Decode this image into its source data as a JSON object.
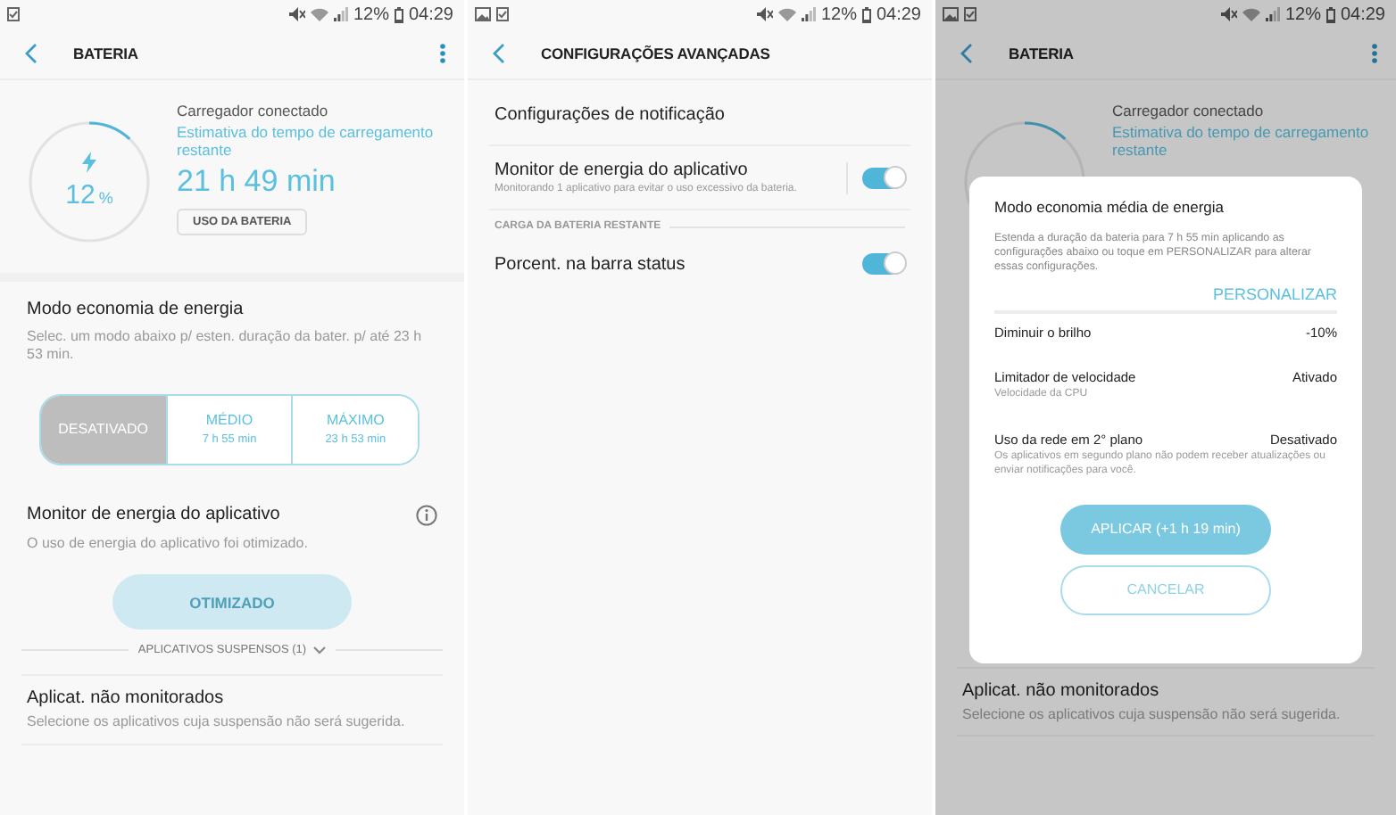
{
  "screens": [
    {
      "kind": "battery",
      "status_bar": {
        "battery": "12%",
        "time": "04:29"
      },
      "header": {
        "title": "BATERIA"
      },
      "charge": {
        "level": 0.12,
        "percent_value": "12",
        "percent_unit": "%",
        "status": "Carregador conectado",
        "estimate_label": "Estimativa do tempo de carregamento restante",
        "estimate": "21 h 49 min",
        "usage_button": "USO DA BATERIA"
      },
      "power_saving": {
        "title": "Modo economia de energia",
        "subtitle": "Selec. um modo abaixo p/ esten. duração da bater. p/ até 23 h 53 min.",
        "modes": [
          {
            "label": "DESATIVADO",
            "selected": true
          },
          {
            "label": "MÉDIO",
            "time": "7 h 55 min",
            "selected": false
          },
          {
            "label": "MÁXIMO",
            "time": "23 h 53 min",
            "selected": false
          }
        ]
      },
      "app_monitor": {
        "title": "Monitor de energia do aplicativo",
        "subtitle": "O uso de energia do aplicativo foi otimizado.",
        "button": "OTIMIZADO",
        "button_disabled": true,
        "suspended": "APLICATIVOS SUSPENSOS (1)"
      },
      "unmonitored": {
        "title": "Aplicat. não monitorados",
        "subtitle": "Selecione os aplicativos cuja suspensão não será sugerida."
      }
    },
    {
      "kind": "advanced",
      "status_bar": {
        "battery": "12%",
        "time": "04:29"
      },
      "header": {
        "title": "CONFIGURAÇÕES AVANÇADAS"
      },
      "items": [
        {
          "kind": "link",
          "title": "Configurações de notificação"
        },
        {
          "kind": "toggle",
          "title": "Monitor de energia do aplicativo",
          "subtitle": "Monitorando 1 aplicativo para evitar o uso excessivo da bateria.",
          "on": true
        },
        {
          "kind": "section",
          "title": "CARGA DA BATERIA RESTANTE"
        },
        {
          "kind": "toggle",
          "title": "Porcent. na barra status",
          "on": true
        }
      ]
    },
    {
      "kind": "battery_dialog",
      "status_bar": {
        "battery": "12%",
        "time": "04:29"
      },
      "header": {
        "title": "BATERIA"
      },
      "charge": {
        "level": 0.12,
        "status": "Carregador conectado",
        "estimate_label": "Estimativa do tempo de carregamento restante"
      },
      "unmonitored": {
        "title": "Aplicat. não monitorados",
        "subtitle": "Selecione os aplicativos cuja suspensão não será sugerida."
      },
      "dialog": {
        "title": "Modo economia média de energia",
        "description": "Estenda a duração da bateria para 7 h 55 min aplicando as configurações abaixo ou toque em PERSONALIZAR para alterar essas configurações.",
        "customize": "PERSONALIZAR",
        "settings": [
          {
            "label": "Diminuir o brilho",
            "value": "-10%"
          },
          {
            "label": "Limitador de velocidade",
            "value": "Ativado",
            "subtitle": "Velocidade da CPU"
          },
          {
            "label": "Uso da rede em 2° plano",
            "value": "Desativado",
            "subtitle": "Os aplicativos em segundo plano não podem receber atualizações ou enviar notificações para você."
          }
        ],
        "apply": "APLICAR (+1 h 19 min)",
        "cancel": "CANCELAR"
      }
    }
  ]
}
